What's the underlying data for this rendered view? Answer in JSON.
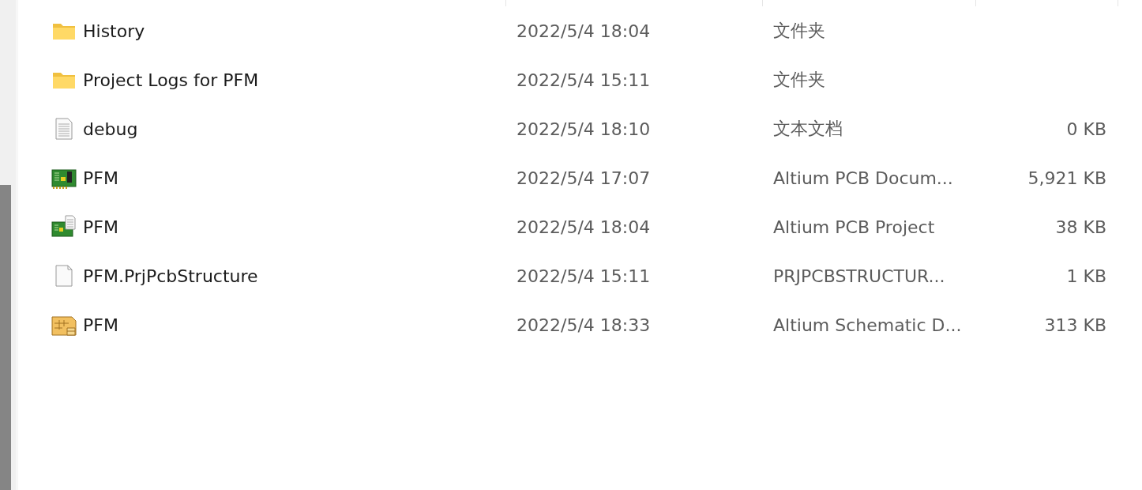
{
  "files": [
    {
      "kind": "folder",
      "name": "History",
      "modified": "2022/5/4 18:04",
      "type": "文件夹"
    },
    {
      "kind": "folder",
      "name": "Project Logs for PFM",
      "modified": "2022/5/4 15:11",
      "type": "文件夹"
    },
    {
      "kind": "text",
      "name": "debug",
      "modified": "2022/5/4 18:10",
      "type": "文本文档",
      "size": "0 KB"
    },
    {
      "kind": "pcb",
      "name": "PFM",
      "modified": "2022/5/4 17:07",
      "type": "Altium PCB Docum...",
      "size": "5,921 KB"
    },
    {
      "kind": "pcb-project",
      "name": "PFM",
      "modified": "2022/5/4 18:04",
      "type": "Altium PCB Project",
      "size": "38 KB"
    },
    {
      "kind": "blank",
      "name": "PFM.PrjPcbStructure",
      "modified": "2022/5/4 15:11",
      "type": "PRJPCBSTRUCTUR...",
      "size": "1 KB"
    },
    {
      "kind": "schematic",
      "name": "PFM",
      "modified": "2022/5/4 18:33",
      "type": "Altium Schematic D...",
      "size": "313 KB"
    }
  ]
}
